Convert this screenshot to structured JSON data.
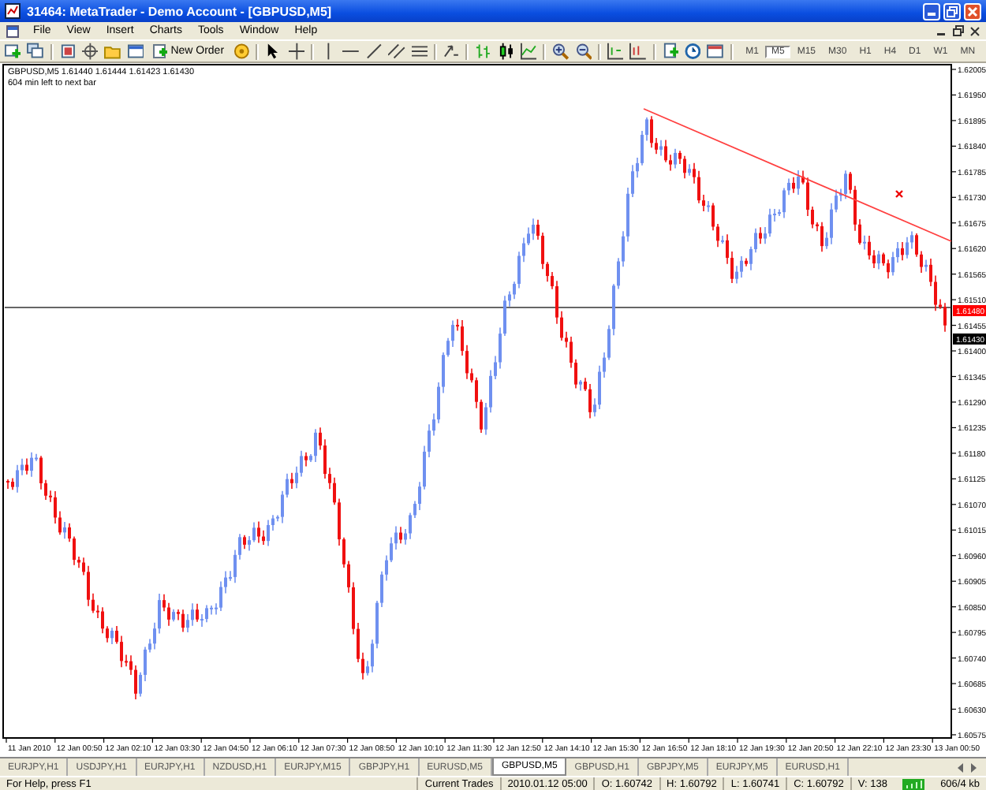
{
  "window": {
    "title": "31464: MetaTrader - Demo Account - [GBPUSD,M5]"
  },
  "menu": [
    "File",
    "View",
    "Insert",
    "Charts",
    "Tools",
    "Window",
    "Help"
  ],
  "toolbar": {
    "new_order": "New Order",
    "timeframes": [
      {
        "label": "M1",
        "selected": false
      },
      {
        "label": "M5",
        "selected": true
      },
      {
        "label": "M15",
        "selected": false
      },
      {
        "label": "M30",
        "selected": false
      },
      {
        "label": "H1",
        "selected": false
      },
      {
        "label": "H4",
        "selected": false
      },
      {
        "label": "D1",
        "selected": false
      },
      {
        "label": "W1",
        "selected": false
      },
      {
        "label": "MN",
        "selected": false
      }
    ]
  },
  "chart": {
    "header": "GBPUSD,M5  1.61440 1.61444 1.61423 1.61430",
    "note": "604 min left to next bar",
    "price_labels": [
      "1.62005",
      "1.61950",
      "1.61895",
      "1.61840",
      "1.61785",
      "1.61730",
      "1.61675",
      "1.61620",
      "1.61565",
      "1.61510",
      "1.61455",
      "1.61400",
      "1.61345",
      "1.61290",
      "1.61235",
      "1.61180",
      "1.61125",
      "1.61070",
      "1.61015",
      "1.60960",
      "1.60905",
      "1.60850",
      "1.60795",
      "1.60740",
      "1.60685",
      "1.60630",
      "1.60575"
    ],
    "line_label": "1.61480",
    "bid_label": "1.61430",
    "time_labels": [
      "11 Jan 2010",
      "12 Jan 00:50",
      "12 Jan 02:10",
      "12 Jan 03:30",
      "12 Jan 04:50",
      "12 Jan 06:10",
      "12 Jan 07:30",
      "12 Jan 08:50",
      "12 Jan 10:10",
      "12 Jan 11:30",
      "12 Jan 12:50",
      "12 Jan 14:10",
      "12 Jan 15:30",
      "12 Jan 16:50",
      "12 Jan 18:10",
      "12 Jan 19:30",
      "12 Jan 20:50",
      "12 Jan 22:10",
      "12 Jan 23:30",
      "13 Jan 00:50"
    ]
  },
  "chart_tabs": [
    {
      "label": "EURJPY,H1",
      "selected": false
    },
    {
      "label": "USDJPY,H1",
      "selected": false
    },
    {
      "label": "EURJPY,H1",
      "selected": false
    },
    {
      "label": "NZDUSD,H1",
      "selected": false
    },
    {
      "label": "EURJPY,M15",
      "selected": false
    },
    {
      "label": "GBPJPY,H1",
      "selected": false
    },
    {
      "label": "EURUSD,M5",
      "selected": false
    },
    {
      "label": "GBPUSD,M5",
      "selected": true
    },
    {
      "label": "GBPUSD,H1",
      "selected": false
    },
    {
      "label": "GBPJPY,M5",
      "selected": false
    },
    {
      "label": "EURJPY,M5",
      "selected": false
    },
    {
      "label": "EURUSD,H1",
      "selected": false
    }
  ],
  "status_bar": {
    "help": "For Help, press F1",
    "profile": "Current Trades",
    "time": "2010.01.12 05:00",
    "open": "O: 1.60742",
    "high": "H: 1.60792",
    "low": "L: 1.60741",
    "close": "C: 1.60792",
    "volume": "V: 138",
    "traffic": "606/4 kb"
  }
}
